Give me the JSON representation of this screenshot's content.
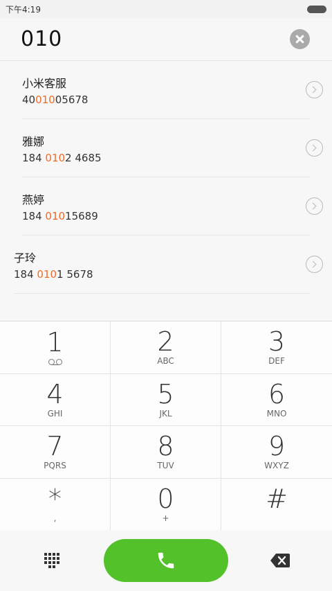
{
  "status": {
    "time": "下午4:19"
  },
  "search": {
    "query": "010"
  },
  "results": [
    {
      "name": "小米客服",
      "num_pre": "40",
      "num_hl": "010",
      "num_post": "05678"
    },
    {
      "name": "雅娜",
      "num_pre": "184 ",
      "num_hl": "010",
      "num_post": "2 4685"
    },
    {
      "name": "燕婷",
      "num_pre": "184 ",
      "num_hl": "010",
      "num_post": "15689"
    },
    {
      "name": "子玲",
      "num_pre": "184 ",
      "num_hl": "010",
      "num_post": "1 5678"
    }
  ],
  "dialpad": {
    "keys": [
      {
        "digit": "1",
        "letters": ""
      },
      {
        "digit": "2",
        "letters": "ABC"
      },
      {
        "digit": "3",
        "letters": "DEF"
      },
      {
        "digit": "4",
        "letters": "GHI"
      },
      {
        "digit": "5",
        "letters": "JKL"
      },
      {
        "digit": "6",
        "letters": "MNO"
      },
      {
        "digit": "7",
        "letters": "PQRS"
      },
      {
        "digit": "8",
        "letters": "TUV"
      },
      {
        "digit": "9",
        "letters": "WXYZ"
      },
      {
        "digit": "*",
        "letters": ","
      },
      {
        "digit": "0",
        "letters": "+"
      },
      {
        "digit": "#",
        "letters": ""
      }
    ]
  },
  "colors": {
    "highlight": "#ef6a26",
    "call_green": "#52c12a"
  },
  "icons": {
    "clear": "clear-icon",
    "chevron": "chevron-right-icon",
    "voicemail": "voicemail-icon",
    "dialpad": "dialpad-grid-icon",
    "call": "phone-icon",
    "backspace": "backspace-icon"
  }
}
